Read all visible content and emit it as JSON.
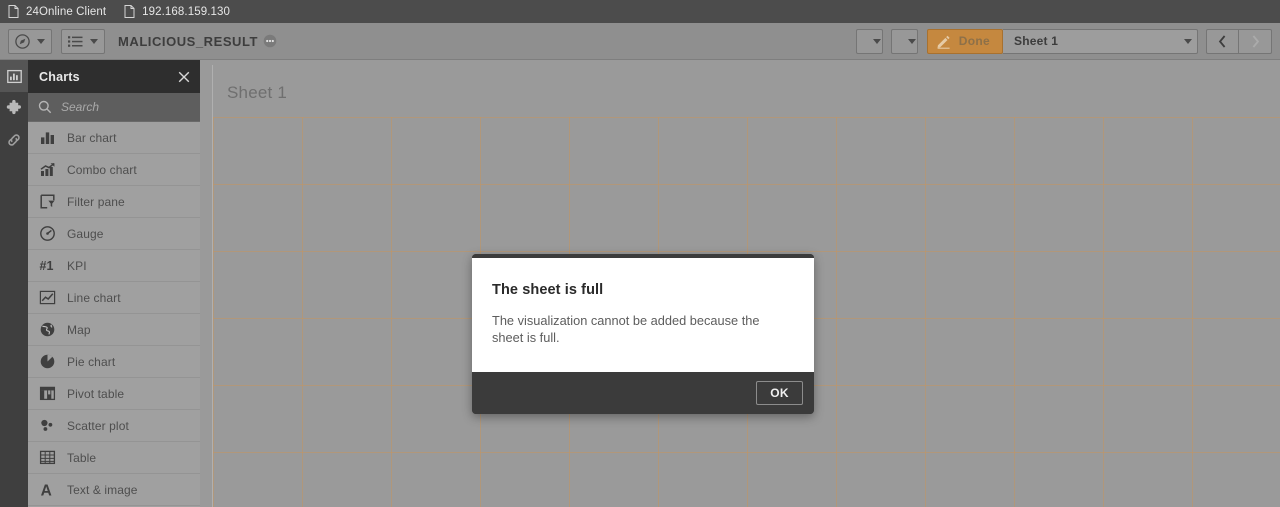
{
  "browser_tabs": [
    {
      "label": "24Online Client",
      "icon": "document-icon"
    },
    {
      "label": "192.168.159.130",
      "icon": "document-icon"
    }
  ],
  "toolbar": {
    "nav_icon": "compass-icon",
    "sheets_icon": "list-icon",
    "app_title": "MALICIOUS_RESULT",
    "app_menu_icon": "more-circle-icon",
    "storytelling_icon": "presentation-icon",
    "bookmark_icon": "bookmark-icon",
    "done_label": "Done",
    "done_icon": "pencil-icon",
    "done_color": "#c5883f",
    "sheet_name": "Sheet 1",
    "sheet_view_icon": "chart-view-icon",
    "prev_icon": "chevron-left-icon",
    "next_icon": "chevron-right-icon"
  },
  "rail": {
    "items": [
      {
        "name": "charts",
        "icon": "bar-chart-icon",
        "active": true
      },
      {
        "name": "custom-objects",
        "icon": "puzzle-icon",
        "active": false
      },
      {
        "name": "master-items",
        "icon": "link-icon",
        "active": false
      }
    ]
  },
  "panel": {
    "title": "Charts",
    "close_icon": "close-icon",
    "search": {
      "placeholder": "Search",
      "value": "",
      "icon": "search-icon"
    },
    "items": [
      {
        "label": "Bar chart",
        "icon": "bar-chart-icon"
      },
      {
        "label": "Combo chart",
        "icon": "combo-chart-icon"
      },
      {
        "label": "Filter pane",
        "icon": "filter-pane-icon"
      },
      {
        "label": "Gauge",
        "icon": "gauge-icon"
      },
      {
        "label": "KPI",
        "icon": "kpi-icon"
      },
      {
        "label": "Line chart",
        "icon": "line-chart-icon"
      },
      {
        "label": "Map",
        "icon": "map-icon"
      },
      {
        "label": "Pie chart",
        "icon": "pie-chart-icon"
      },
      {
        "label": "Pivot table",
        "icon": "pivot-table-icon"
      },
      {
        "label": "Scatter plot",
        "icon": "scatter-plot-icon"
      },
      {
        "label": "Table",
        "icon": "table-icon"
      },
      {
        "label": "Text & image",
        "icon": "text-image-icon"
      }
    ]
  },
  "sheet": {
    "title": "Sheet 1",
    "grid_color": "#c49560"
  },
  "dialog": {
    "title": "The sheet is full",
    "message": "The visualization cannot be added because the sheet is full.",
    "ok_label": "OK"
  }
}
